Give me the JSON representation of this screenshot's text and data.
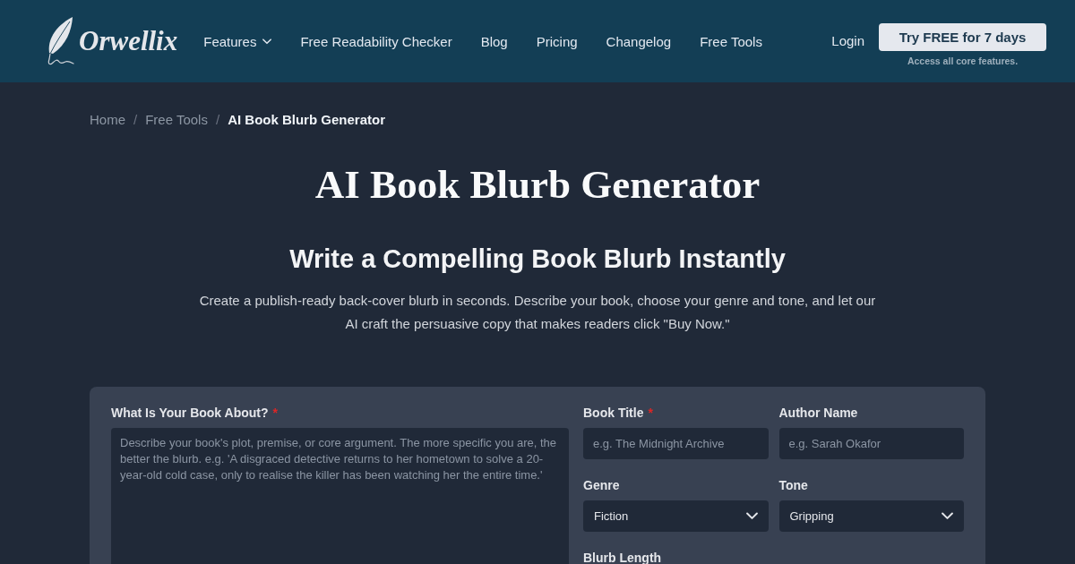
{
  "header": {
    "logo": {
      "name": "Orwellix"
    },
    "nav": [
      {
        "label": "Features",
        "has_dropdown": true
      },
      {
        "label": "Free Readability Checker",
        "has_dropdown": false
      },
      {
        "label": "Blog",
        "has_dropdown": false
      },
      {
        "label": "Pricing",
        "has_dropdown": false
      },
      {
        "label": "Changelog",
        "has_dropdown": false
      },
      {
        "label": "Free Tools",
        "has_dropdown": false
      }
    ],
    "login": "Login",
    "cta": {
      "label": "Try FREE for 7 days",
      "note": "Access all core features."
    }
  },
  "breadcrumb": {
    "items": [
      {
        "label": "Home",
        "current": false
      },
      {
        "label": "Free Tools",
        "current": false
      },
      {
        "label": "AI Book Blurb Generator",
        "current": true
      }
    ],
    "separators": [
      "/",
      "/"
    ]
  },
  "hero": {
    "title": "AI Book Blurb Generator",
    "subtitle": "Write a Compelling Book Blurb Instantly",
    "description": "Create a publish-ready back-cover blurb in seconds. Describe your book, choose your genre and tone, and let our AI craft the persuasive copy that makes readers click \"Buy Now.\""
  },
  "form": {
    "description_field": {
      "label": "What Is Your Book About?",
      "required_mark": "*",
      "placeholder": "Describe your book's plot, premise, or core argument. The more specific you are, the better the blurb. e.g. 'A disgraced detective returns to her hometown to solve a 20-year-old cold case, only to realise the killer has been watching her the entire time.'"
    },
    "fields": [
      {
        "kind": "input",
        "label": "Book Title",
        "required_mark": "*",
        "placeholder": "e.g. The Midnight Archive"
      },
      {
        "kind": "input",
        "label": "Author Name",
        "placeholder": "e.g. Sarah Okafor"
      },
      {
        "kind": "select",
        "label": "Genre",
        "value": "Fiction"
      },
      {
        "kind": "select",
        "label": "Tone",
        "value": "Gripping"
      },
      {
        "kind": "label",
        "label": "Blurb Length"
      }
    ]
  }
}
